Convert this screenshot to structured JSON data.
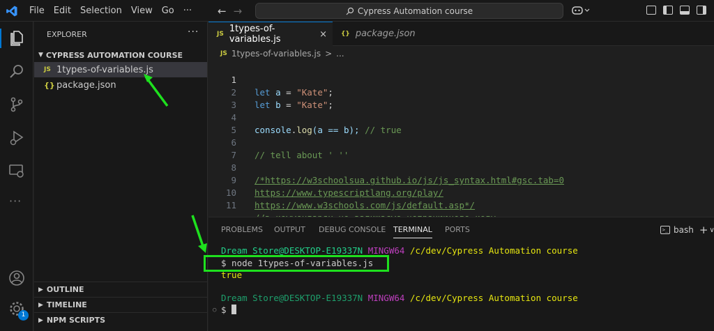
{
  "titlebar": {
    "menu": [
      "File",
      "Edit",
      "Selection",
      "View",
      "Go",
      "···"
    ],
    "search_text": "Cypress Automation course",
    "back_arrow": "←",
    "forward_arrow": "→"
  },
  "activity": {
    "items": [
      "explorer-icon",
      "search-icon",
      "source-control-icon",
      "run-debug-icon",
      "remote-explorer-icon",
      "more-icon",
      "account-icon",
      "manage-gear-icon"
    ],
    "badge_count": "1"
  },
  "sidebar": {
    "title": "EXPLORER",
    "more": "···",
    "folder": "CYPRESS AUTOMATION COURSE",
    "files": [
      {
        "icon": "JS",
        "name": "1types-of-variables.js"
      },
      {
        "icon": "{}",
        "name": "package.json"
      }
    ],
    "sections": [
      "OUTLINE",
      "TIMELINE",
      "NPM SCRIPTS"
    ]
  },
  "tabs": [
    {
      "icon": "JS",
      "label": "1types-of-variables.js",
      "close": "×"
    },
    {
      "icon": "{}",
      "label": "package.json"
    }
  ],
  "breadcrumb": {
    "icon": "JS",
    "file": "1types-of-variables.js",
    "sep": ">",
    "rest": "..."
  },
  "code_lines": [
    {
      "n": "1"
    },
    {
      "n": "2"
    },
    {
      "n": "3"
    },
    {
      "n": "4"
    },
    {
      "n": "5"
    },
    {
      "n": "6"
    },
    {
      "n": "7"
    },
    {
      "n": "8"
    },
    {
      "n": "9"
    },
    {
      "n": "10"
    },
    {
      "n": "11"
    }
  ],
  "code": {
    "l1": {
      "kw": "let",
      "var": "a",
      "op": "=",
      "str": "\"Kate\"",
      "end": ";"
    },
    "l2": {
      "kw": "let",
      "var": "b",
      "op": "=",
      "str": "\"Kate\"",
      "end": ";"
    },
    "l4": {
      "obj": "console",
      "fn": "log",
      "args": "(a == b);",
      "cm": "// true"
    },
    "l6": "// tell about ' ''",
    "l8": "/*https://w3schoolsua.github.io/js/js_syntax.html#gsc.tab=0",
    "l9": "https://www.typescriptlang.org/play/",
    "l10": "https://www.w3schools.com/js/default.asp*/",
    "l11": "//в комментарях не залишаємо непрацюючого коду"
  },
  "panel": {
    "tabs": [
      "PROBLEMS",
      "OUTPUT",
      "DEBUG CONSOLE",
      "TERMINAL",
      "PORTS"
    ],
    "active_tab": "TERMINAL",
    "shell_label": "bash",
    "add": "+",
    "dropdown": "∨"
  },
  "terminal": {
    "user": "Dream Store@DESKTOP-E19337N",
    "host": "MINGW64",
    "path": "/c/dev/Cypress Automation course",
    "command": "$ node 1types-of-variables.js",
    "output": "true",
    "prompt": "$"
  }
}
